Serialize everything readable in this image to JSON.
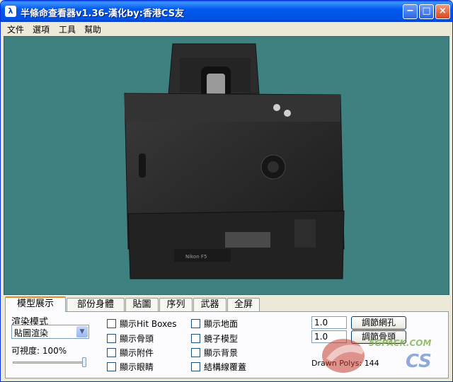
{
  "window": {
    "title": "半條命查看器v1.36-漢化by:香港CS友"
  },
  "titlebar": {
    "icon": "app-icon",
    "minimize": "−",
    "maximize": "□",
    "close": "×"
  },
  "menu": [
    "文件",
    "選項",
    "工具",
    "幫助"
  ],
  "tabs": [
    "模型展示",
    "部份身體",
    "貼圖",
    "序列",
    "武器",
    "全屏"
  ],
  "render": {
    "mode_label": "渲染模式",
    "mode_value": "貼圖渲染",
    "visibility_label": "可視度:",
    "visibility_value": "100%",
    "visibility_level": 1.0
  },
  "checkboxes_col1": [
    "顯示Hit Boxes",
    "顯示骨頭",
    "顯示附件",
    "顯示眼睛"
  ],
  "checkboxes_col2": [
    "顯示地面",
    "鏡子模型",
    "顯示背景",
    "結構線覆蓋"
  ],
  "controls": {
    "mesh_value": "1.0",
    "mesh_button": "調節網孔",
    "bone_value": "1.0",
    "bone_button": "調節骨頭",
    "drawn_polys_label": "Drawn Polys:",
    "drawn_polys_value": "144"
  },
  "camera_logo_text": "Nikon F5",
  "watermark_text": "5GPACK.COM",
  "watermark_logo_text": "CS",
  "colors": {
    "viewport": "#3f8080",
    "titlebar": "#0058ee",
    "tab_accent": "#e68b2c"
  }
}
